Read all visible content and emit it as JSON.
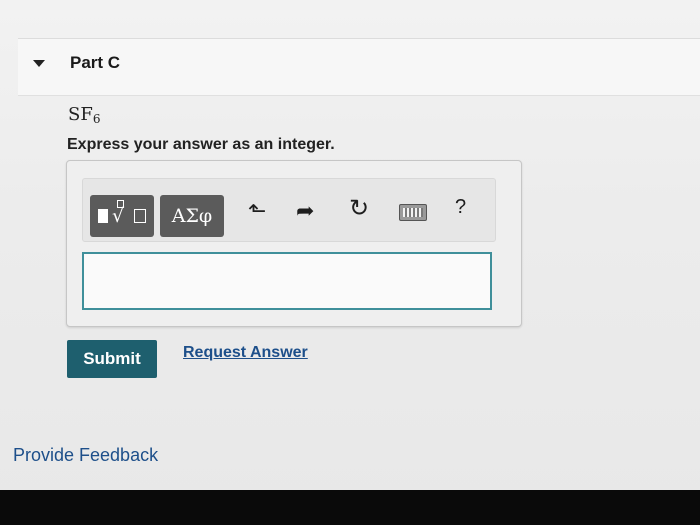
{
  "part": {
    "title": "Part C"
  },
  "question": {
    "formula_base": "SF",
    "formula_subscript": "6",
    "instruction": "Express your answer as an integer."
  },
  "toolbar": {
    "symbols_label": "ΑΣφ",
    "undo_glyph": "⬑",
    "redo_glyph": "➦",
    "reset_glyph": "↻",
    "help_label": "?",
    "icons": [
      "templates-icon",
      "symbols-icon",
      "undo-icon",
      "redo-icon",
      "reset-icon",
      "keyboard-icon",
      "help-icon"
    ]
  },
  "answer": {
    "value": "",
    "placeholder": ""
  },
  "actions": {
    "submit_label": "Submit",
    "request_label": "Request Answer"
  },
  "footer": {
    "feedback_label": "Provide Feedback"
  },
  "colors": {
    "submit_bg": "#1e5f6e",
    "link": "#1d4f8a",
    "input_border": "#3f8f9a",
    "toolbar_button": "#5b5b5b"
  }
}
